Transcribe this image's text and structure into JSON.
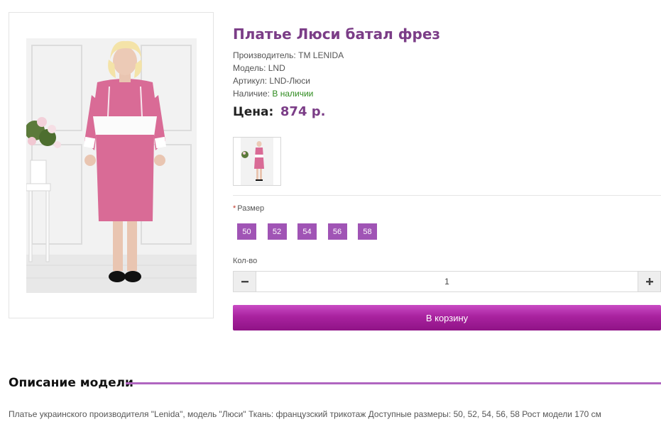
{
  "product": {
    "title": "Платье Люси батал фрез",
    "meta": [
      {
        "label": "Производитель:",
        "value": "TM LENIDA"
      },
      {
        "label": "Модель:",
        "value": "LND"
      },
      {
        "label": "Артикул:",
        "value": "LND-Люси"
      },
      {
        "label": "Наличие:",
        "value": "В наличии"
      }
    ],
    "price_label": "Цена:",
    "price_value": "874 р."
  },
  "options": {
    "size_label": "Размер",
    "required_mark": "*",
    "sizes": [
      "50",
      "52",
      "54",
      "56",
      "58"
    ],
    "qty_label": "Кол-во",
    "qty_value": "1",
    "minus_icon": "minus-icon",
    "plus_icon": "plus-icon"
  },
  "cart": {
    "label": "В корзину"
  },
  "description": {
    "heading": "Описание модели",
    "text": "Платье украинского производителя \"Lenida\", модель \"Люси\" Ткань: французский трикотаж Доступные размеры: 50, 52, 54, 56, 58 Рост модели 170 см"
  },
  "colors": {
    "accent": "#7b3d87",
    "size_button": "#a054b5",
    "cart_button": "#a9229f",
    "in_stock": "#2e8b1e"
  }
}
